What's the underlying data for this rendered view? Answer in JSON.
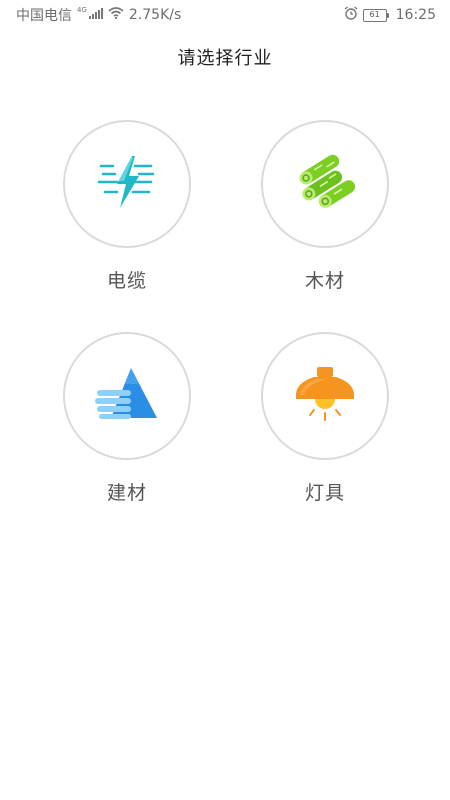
{
  "status_bar": {
    "carrier": "中国电信",
    "network": "4G",
    "speed": "2.75K/s",
    "battery": "61",
    "time": "16:25"
  },
  "page": {
    "title": "请选择行业"
  },
  "industries": [
    {
      "label": "电缆",
      "icon": "lightning-icon",
      "color": "#1fb8c8"
    },
    {
      "label": "木材",
      "icon": "logs-icon",
      "color": "#6cc11e"
    },
    {
      "label": "建材",
      "icon": "building-material-icon",
      "color": "#2a8ee6"
    },
    {
      "label": "灯具",
      "icon": "lamp-icon",
      "color": "#f5941f"
    }
  ]
}
